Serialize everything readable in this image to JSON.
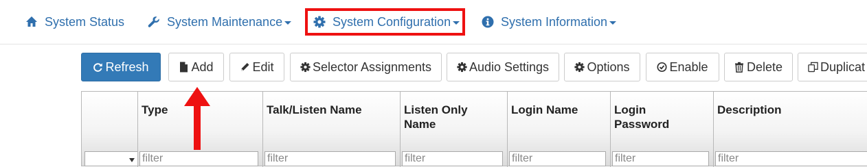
{
  "nav": {
    "items": [
      {
        "label": "System Status",
        "icon": "home-icon",
        "has_caret": false
      },
      {
        "label": "System Maintenance",
        "icon": "wrench-icon",
        "has_caret": true
      },
      {
        "label": "System Configuration",
        "icon": "gear-icon",
        "has_caret": true,
        "highlighted": true
      },
      {
        "label": "System Information",
        "icon": "info-circle-icon",
        "has_caret": true
      }
    ]
  },
  "toolbar": {
    "refresh": "Refresh",
    "add": "Add",
    "edit": "Edit",
    "selector": "Selector Assignments",
    "audio": "Audio Settings",
    "options": "Options",
    "enable": "Enable",
    "delete": "Delete",
    "duplicate": "Duplicat"
  },
  "grid": {
    "columns": [
      {
        "header": "",
        "filter_type": "select"
      },
      {
        "header": "Type",
        "filter_placeholder": "filter"
      },
      {
        "header": "Talk/Listen Name",
        "filter_placeholder": "filter"
      },
      {
        "header": "Listen Only Name",
        "filter_placeholder": "filter"
      },
      {
        "header": "Login Name",
        "filter_placeholder": "filter"
      },
      {
        "header": "Login Password",
        "filter_placeholder": "filter"
      },
      {
        "header": "Description",
        "filter_placeholder": "filter"
      }
    ]
  },
  "colors": {
    "link": "#2f6fad",
    "primary_button": "#337ab7",
    "highlight": "#ee1111"
  }
}
